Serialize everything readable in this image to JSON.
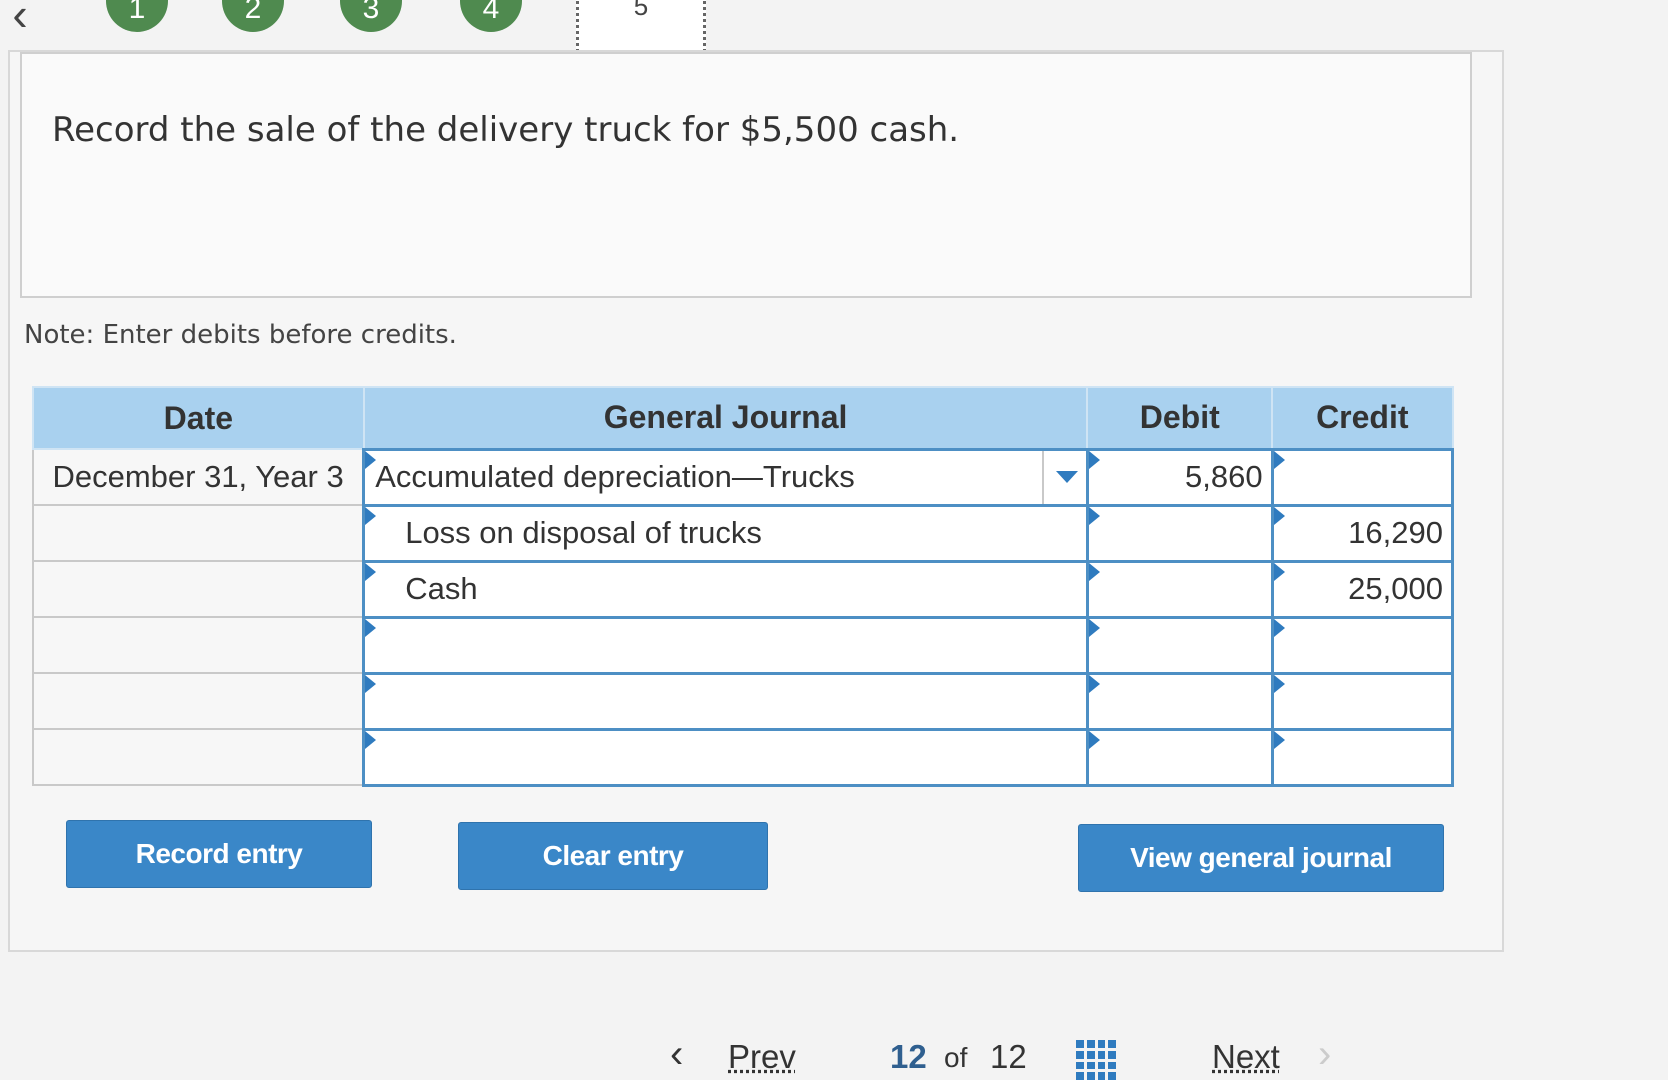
{
  "steps": [
    "1",
    "2",
    "3",
    "4",
    "5"
  ],
  "prompt": "Record the sale of the delivery truck for $5,500 cash.",
  "note": "Note: Enter debits before credits.",
  "journal": {
    "headers": {
      "date": "Date",
      "account": "General Journal",
      "debit": "Debit",
      "credit": "Credit"
    },
    "rows": [
      {
        "date": "December 31, Year 3",
        "account": "Accumulated depreciation—Trucks",
        "debit": "5,860",
        "credit": ""
      },
      {
        "date": "",
        "account": "Loss on disposal of trucks",
        "debit": "",
        "credit": "16,290"
      },
      {
        "date": "",
        "account": "Cash",
        "debit": "",
        "credit": "25,000"
      },
      {
        "date": "",
        "account": "",
        "debit": "",
        "credit": ""
      },
      {
        "date": "",
        "account": "",
        "debit": "",
        "credit": ""
      },
      {
        "date": "",
        "account": "",
        "debit": "",
        "credit": ""
      }
    ]
  },
  "buttons": {
    "record": "Record entry",
    "clear": "Clear entry",
    "view": "View general journal"
  },
  "pager": {
    "prev": "Prev",
    "current": "12",
    "of": "of",
    "total": "12",
    "next": "Next"
  },
  "colors": {
    "header_bg": "#a9d1ef",
    "button_bg": "#3a87c8",
    "step_bg": "#4f8a4f",
    "accent": "#2f7bbf"
  },
  "icons": {
    "back": "chevron-left-icon",
    "grid": "grid-icon",
    "prev": "chevron-left-icon",
    "next": "chevron-right-icon",
    "dropdown": "dropdown-arrow-icon"
  }
}
